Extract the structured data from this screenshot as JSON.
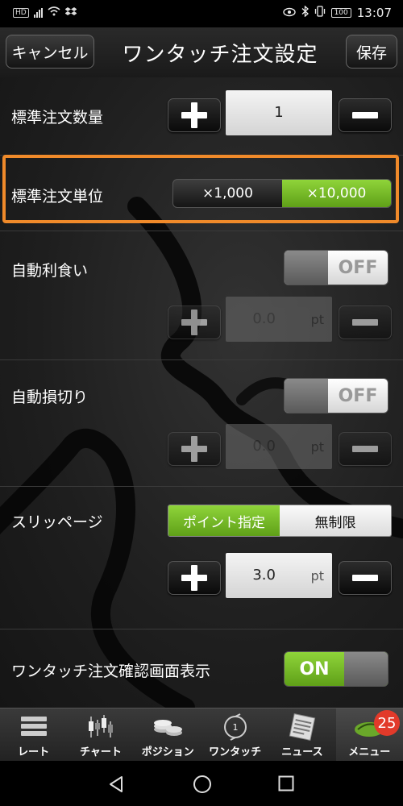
{
  "status_bar": {
    "left_badge": "HD",
    "time": "13:07",
    "battery": "100"
  },
  "header": {
    "cancel_label": "キャンセル",
    "title": "ワンタッチ注文設定",
    "save_label": "保存"
  },
  "settings": {
    "order_quantity": {
      "label": "標準注文数量",
      "value": "1"
    },
    "order_unit": {
      "label": "標準注文単位",
      "options": [
        "×1,000",
        "×10,000"
      ],
      "selected": "×10,000"
    },
    "take_profit": {
      "label": "自動利食い",
      "toggle": "OFF",
      "value": "0.0",
      "unit": "pt"
    },
    "stop_loss": {
      "label": "自動損切り",
      "toggle": "OFF",
      "value": "0.0",
      "unit": "pt"
    },
    "slippage": {
      "label": "スリッページ",
      "options": [
        "ポイント指定",
        "無制限"
      ],
      "selected": "ポイント指定",
      "value": "3.0",
      "unit": "pt"
    },
    "confirm_screen": {
      "label": "ワンタッチ注文確認画面表示",
      "toggle": "ON"
    }
  },
  "tabbar": {
    "tabs": [
      {
        "label": "レート",
        "icon": "rate-list-icon"
      },
      {
        "label": "チャート",
        "icon": "candlestick-chart-icon"
      },
      {
        "label": "ポジション",
        "icon": "coins-icon"
      },
      {
        "label": "ワンタッチ",
        "icon": "sell-buy-icon"
      },
      {
        "label": "ニュース",
        "icon": "newspaper-icon"
      },
      {
        "label": "メニュー",
        "icon": "menu-logo-icon"
      }
    ],
    "active": "メニュー",
    "menu_badge": "25"
  },
  "colors": {
    "accent_green": "#7bc22a",
    "highlight_orange": "#f08a2a",
    "badge_red": "#e23a2a"
  }
}
